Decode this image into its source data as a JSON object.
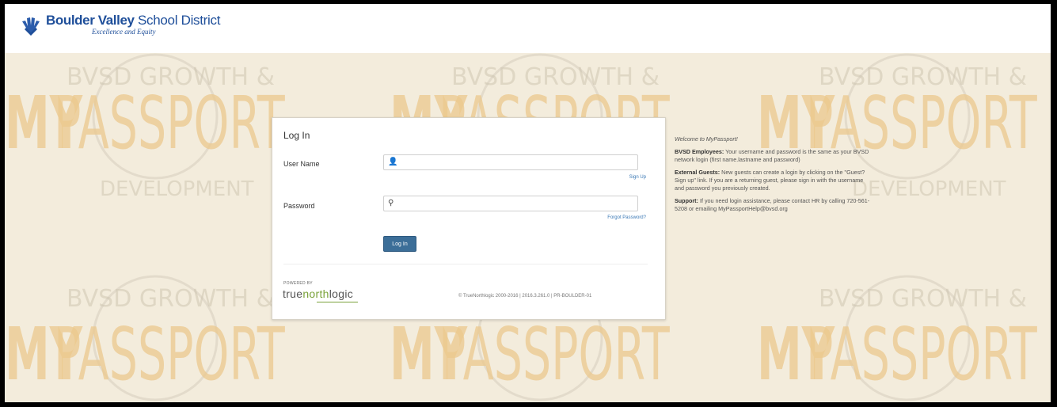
{
  "header": {
    "brand_bold": "Boulder Valley",
    "brand_rest": " School District",
    "tagline": "Excellence and Equity"
  },
  "background": {
    "word_a": "MY",
    "word_b": "PASSPORT",
    "growth": "BVSD GROWTH &",
    "development": "DEVELOPMENT"
  },
  "login": {
    "title": "Log In",
    "username_label": "User Name",
    "username_value": "",
    "username_icon": "user-icon",
    "password_label": "Password",
    "password_value": "",
    "password_icon": "key-icon",
    "signup_link": "Sign Up",
    "forgot_link": "Forgot Password?",
    "submit_label": "Log In"
  },
  "footer": {
    "powered_by": "POWERED BY",
    "brand_a": "true",
    "brand_b": "north",
    "brand_c": "logic",
    "copyright": "© TrueNorthlogic 2000-2016 | 2016.3.261.0 | PR-BOULDER-01"
  },
  "info": {
    "welcome": "Welcome to MyPassport!",
    "employees_title": "BVSD Employees:",
    "employees_text": " Your username and password is the same as your BVSD network login (first name.lastname and password)",
    "guests_title": "External Guests:",
    "guests_text": " New guests can create a login by clicking on the \"Guest? Sign up\" link. If you are a returning guest, please sign in with the username and password you previously created.",
    "support_title": "Support:",
    "support_text": " If you need login assistance, please contact HR by calling 720-561-5208 or emailing MyPassportHelp@bvsd.org"
  },
  "colors": {
    "brand_blue": "#1f4f9a",
    "button_blue": "#3c6e98",
    "link_blue": "#3a78b5",
    "tnl_green": "#7aa23a",
    "background": "#f3ecdc",
    "watermark": "#ecc98e"
  }
}
